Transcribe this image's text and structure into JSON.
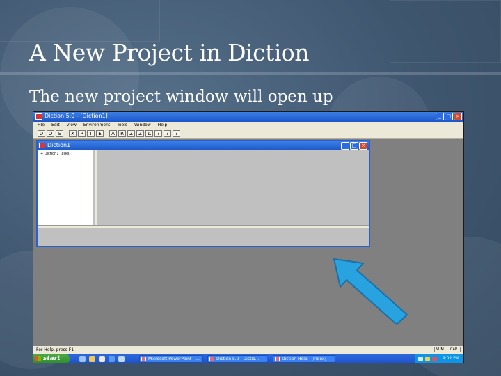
{
  "slide": {
    "title": "A New Project in Diction",
    "body": "The new project window will open up"
  },
  "app": {
    "title": "Diction 5.0 - [Diction1]",
    "minimize": "_",
    "maximize": "□",
    "close": "×"
  },
  "menu": [
    "File",
    "Edit",
    "View",
    "Environment",
    "Tools",
    "Window",
    "Help"
  ],
  "toolbar": {
    "buttons": [
      "D",
      "O",
      "S",
      "X",
      "P",
      "T",
      "E",
      "A",
      "R",
      "Z",
      "Z",
      "Δ",
      "?",
      "?",
      "?"
    ]
  },
  "child": {
    "title": "Diction1",
    "tree_item": "+ Diction1 Tasks",
    "minimize": "_",
    "maximize": "□",
    "close": "×"
  },
  "status": {
    "text": "For Help, press F1",
    "box1": "NUM",
    "box2": "CAP"
  },
  "taskbar": {
    "start": "start",
    "tasks": [
      "Microsoft PowerPoint - ...",
      "Diction 5.0 - Dictio...",
      "Diction Help - [Index]"
    ],
    "time": "9:02 PM"
  },
  "colors": {
    "accent_arrow": "#29a3e0",
    "titlebar": "#1c56c9",
    "start_green": "#3a9c35"
  }
}
